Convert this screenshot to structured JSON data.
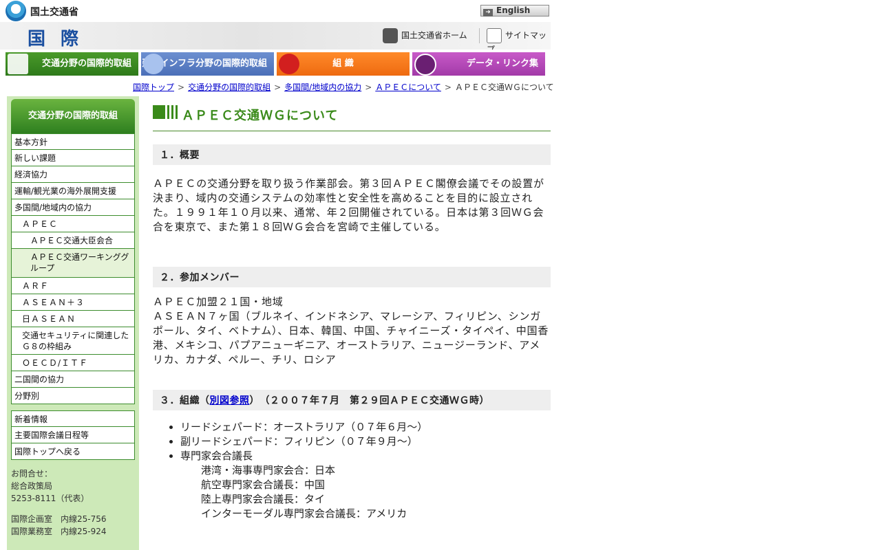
{
  "header": {
    "ministry": "国土交通省",
    "english_label": "English",
    "banner_title": "国際",
    "home_label": "国土交通省ホーム",
    "sitemap_label": "サイトマップ"
  },
  "nav": [
    {
      "label": "交通分野の国際的取組"
    },
    {
      "label": "建設インフラ分野の国際的取組"
    },
    {
      "label": "組 織"
    },
    {
      "label": "データ・リンク集"
    }
  ],
  "breadcrumb": [
    {
      "label": "国際トップ",
      "link": true
    },
    {
      "label": "交通分野の国際的取組",
      "link": true
    },
    {
      "label": "多国間/地域内の協力",
      "link": true
    },
    {
      "label": "ＡＰＥＣについて",
      "link": true
    },
    {
      "label": "ＡＰＥＣ交通ＷＧについて",
      "link": false
    }
  ],
  "sidebar": {
    "heading": "交通分野の国際的取組",
    "items": [
      "基本方針",
      "新しい課題",
      "経済協力",
      "運輸/観光業の海外展開支援",
      "多国間/地域内の協力",
      "ＡＰＥＣ",
      "ＡＰＥＣ交通大臣会合",
      "ＡＰＥＣ交通ワーキンググループ",
      "ＡＲＦ",
      "ＡＳＥＡＮ＋３",
      "日ＡＳＥＡＮ",
      "交通セキュリティに関連したＧ８の枠組み",
      "ＯＥＣＤ/ＩＴＦ",
      "二国間の協力",
      "分野別"
    ],
    "items2": [
      "新着情報",
      "主要国際会議日程等",
      "国際トップへ戻る"
    ],
    "contact": {
      "label": "お問合せ：",
      "bureau": "総合政策局",
      "phone": "5253-8111（代表）",
      "office1": "国際企画室　内線25-756",
      "office2": "国際業務室　内線25-924"
    }
  },
  "content": {
    "title": "ＡＰＥＣ交通ＷＧについて",
    "s1_heading": "１．概要",
    "s1_body": "ＡＰＥＣの交通分野を取り扱う作業部会。第３回ＡＰＥＣ閣僚会議でその設置が決まり、域内の交通システムの効率性と安全性を高めることを目的に設立された。１９９１年１０月以来、通常、年２回開催されている。日本は第３回ＷＧ会合を東京で、また第１８回ＷＧ会合を宮崎で主催している。",
    "s2_heading": "２．参加メンバー",
    "s2_line1": "ＡＰＥＣ加盟２１国・地域",
    "s2_line2": "ＡＳＥＡＮ７ヶ国（ブルネイ、インドネシア、マレーシア、フィリピン、シンガポール、タイ、ベトナム）、日本、韓国、中国、チャイニーズ・タイペイ、中国香港、メキシコ、パプアニューギニア、オーストラリア、ニュージーランド、アメリカ、カナダ、ペルー、チリ、ロシア",
    "s3_prefix": "３．組織（",
    "s3_link": "別図参照",
    "s3_suffix": "）　（２００７年７月　第２９回ＡＰＥＣ交通ＷＧ時）",
    "roles": [
      "リードシェパード：オーストラリア（０７年６月～）",
      "副リードシェパード：フィリピン（０７年９月～）",
      "専門家会合議長"
    ],
    "chairs": [
      "港湾・海事専門家会合：日本",
      "航空専門家会合議長：中国",
      "陸上専門家会合議長：タイ",
      "インターモーダル専門家会合議長：アメリカ"
    ]
  }
}
